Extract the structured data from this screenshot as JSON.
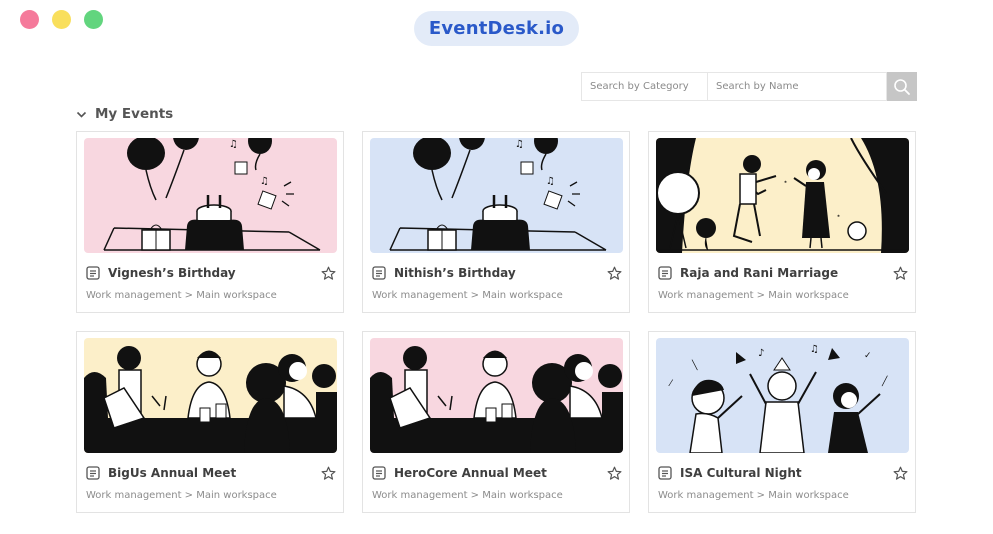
{
  "window": {
    "controls": [
      "close",
      "minimize",
      "maximize"
    ]
  },
  "brand": {
    "title": "EventDesk.io",
    "color": "#2a59c9",
    "background": "#e3ebf8"
  },
  "search": {
    "category_placeholder": "Search by Category",
    "name_placeholder": "Search by Name",
    "button_icon": "search-icon"
  },
  "section": {
    "title": "My Events",
    "icon": "chevron-down-icon"
  },
  "events": [
    {
      "name": "Vignesh’s Birthday",
      "path": "Work management > Main workspace",
      "illustration": "birthday-party",
      "bg": "#f8d7e0"
    },
    {
      "name": "Nithish’s Birthday",
      "path": "Work management > Main workspace",
      "illustration": "birthday-party",
      "bg": "#d7e3f6"
    },
    {
      "name": "Raja and Rani Marriage",
      "path": "Work management > Main workspace",
      "illustration": "stage-couple",
      "bg": "#fcefc9"
    },
    {
      "name": "BigUs Annual Meet",
      "path": "Work management > Main workspace",
      "illustration": "meeting-table",
      "bg": "#fcefc9"
    },
    {
      "name": "HeroCore Annual Meet",
      "path": "Work management > Main workspace",
      "illustration": "meeting-table",
      "bg": "#f8d7e0"
    },
    {
      "name": "ISA Cultural Night",
      "path": "Work management > Main workspace",
      "illustration": "celebration-crowd",
      "bg": "#d7e3f6"
    }
  ]
}
